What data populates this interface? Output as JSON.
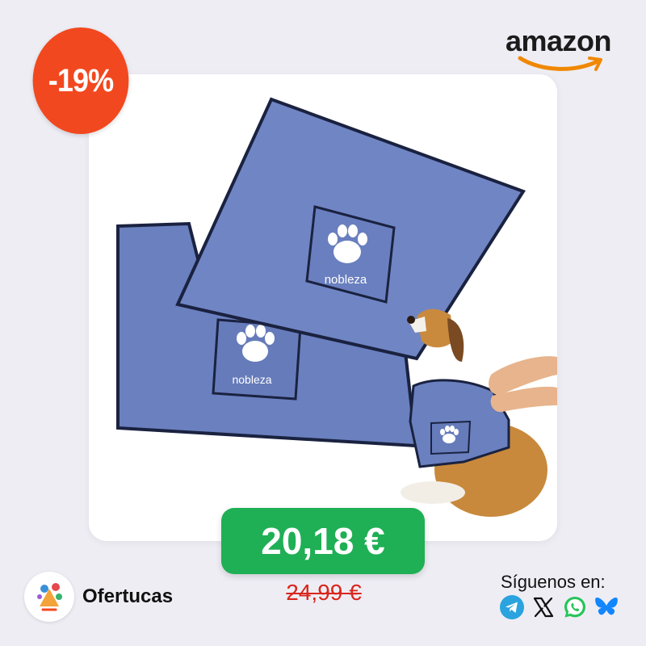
{
  "discount": {
    "label": "-19%"
  },
  "store": {
    "name": "amazon"
  },
  "price": {
    "current": "20,18 €",
    "original": "24,99 €"
  },
  "brand": {
    "name": "Ofertucas"
  },
  "product": {
    "print_text": "nobleza"
  },
  "social": {
    "label": "Síguenos en:",
    "icons": [
      "telegram-icon",
      "x-icon",
      "whatsapp-icon",
      "bluesky-icon"
    ]
  },
  "colors": {
    "background": "#eeedf4",
    "discount": "#f2481f",
    "price": "#1faf55",
    "old_price": "#d9261c",
    "towel": "#6a80bf",
    "amazon_smile": "#f08804"
  }
}
